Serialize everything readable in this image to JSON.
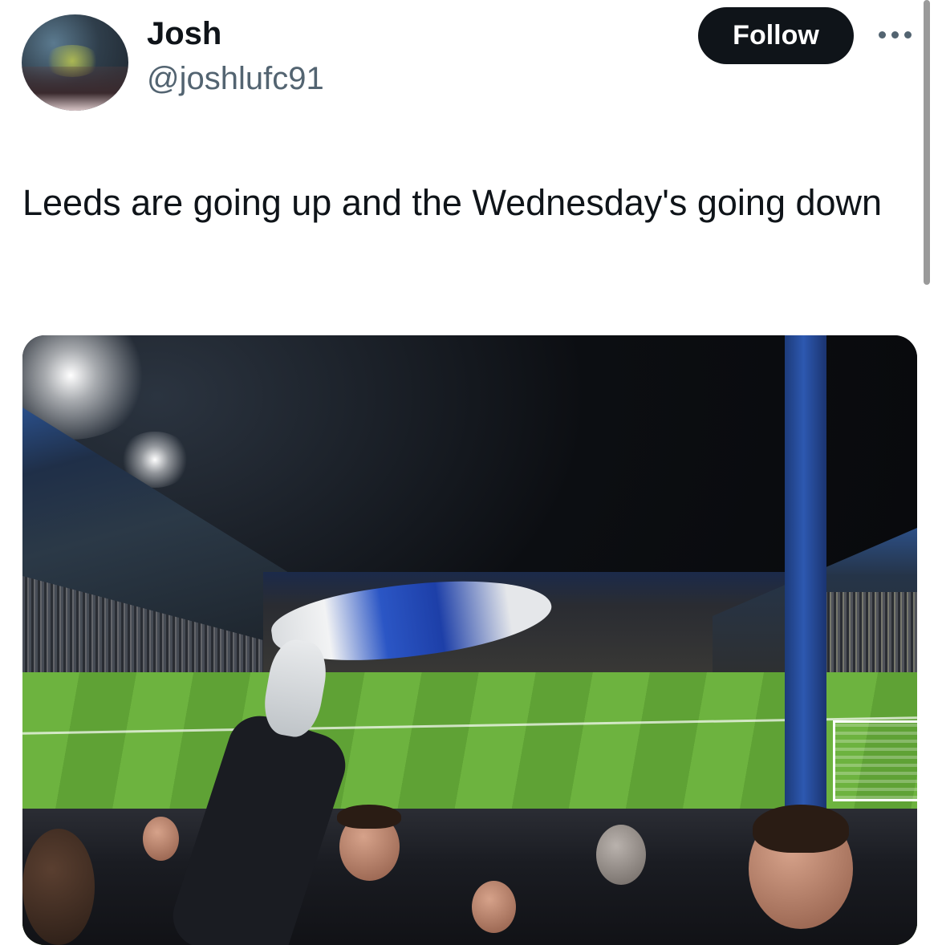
{
  "author": {
    "name": "Josh",
    "handle": "@joshlufc91"
  },
  "actions": {
    "follow_label": "Follow"
  },
  "tweet": {
    "text": "Leeds are going up and the Wednesday's going down"
  },
  "icons": {
    "more": "more-horizontal-icon"
  },
  "colors": {
    "follow_bg": "#0f1419",
    "follow_text": "#ffffff",
    "handle_text": "#536471"
  }
}
